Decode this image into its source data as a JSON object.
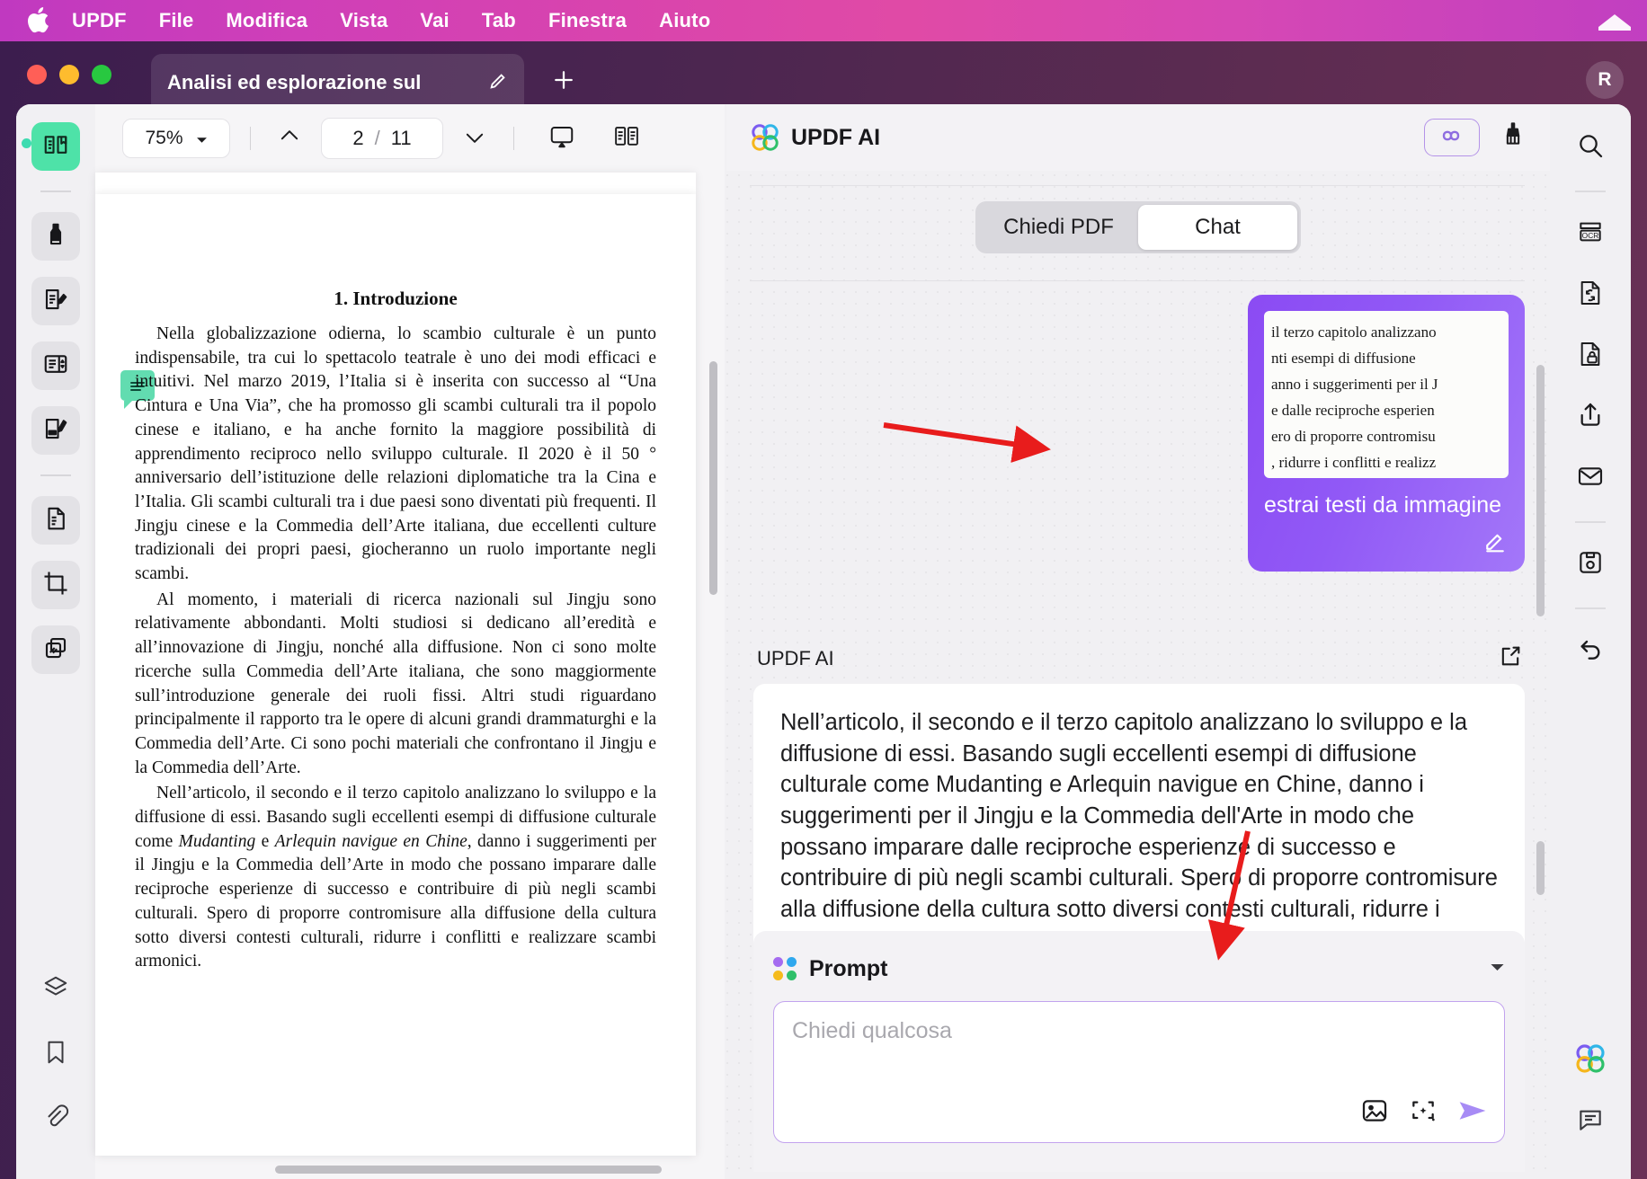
{
  "menubar": {
    "apple_icon": "apple-logo-icon",
    "items": [
      "UPDF",
      "File",
      "Modifica",
      "Vista",
      "Vai",
      "Tab",
      "Finestra",
      "Aiuto"
    ],
    "right_icon": "notification-center-icon"
  },
  "window": {
    "tab_title": "Analisi ed esplorazione sul",
    "tab_edit_icon": "pencil-icon",
    "new_tab_icon": "plus-icon",
    "avatar_initial": "R"
  },
  "left_rail": {
    "tools": [
      {
        "name": "reader-view-tool",
        "icon": "book-open-icon",
        "active": true
      },
      {
        "name": "highlight-tool",
        "icon": "marker-pen-icon",
        "active": false
      },
      {
        "name": "annotate-tool",
        "icon": "document-pencil-icon",
        "active": false
      },
      {
        "name": "edit-pdf-tool",
        "icon": "document-columns-icon",
        "active": false
      },
      {
        "name": "fill-sign-tool",
        "icon": "document-signature-icon",
        "active": false
      },
      {
        "name": "organize-pages-tool",
        "icon": "document-pages-icon",
        "active": false
      },
      {
        "name": "crop-tool",
        "icon": "crop-icon",
        "active": false
      },
      {
        "name": "batch-tool",
        "icon": "stacked-pages-icon",
        "active": false
      },
      {
        "name": "layers-tool",
        "icon": "layers-icon",
        "active": false
      },
      {
        "name": "bookmarks-tool",
        "icon": "bookmark-icon",
        "active": false
      },
      {
        "name": "attachments-tool",
        "icon": "paperclip-icon",
        "active": false
      }
    ]
  },
  "viewer": {
    "zoom_level": "75%",
    "zoom_caret_icon": "chevron-down-icon",
    "prev_page_icon": "chevrons-up-icon",
    "next_page_icon": "chevrons-down-icon",
    "current_page": "2",
    "page_separator": "/",
    "total_pages": "11",
    "present_icon": "presentation-icon",
    "layout_icon": "split-view-icon",
    "annotation_icon": "note-comment-icon"
  },
  "document": {
    "heading": "1. Introduzione",
    "paragraphs": [
      "Nella globalizzazione odierna, lo scambio culturale è un punto indispensabile, tra cui lo spettacolo teatrale è uno dei modi efficaci e intuitivi. Nel marzo 2019, l’Italia si è inserita con successo al “Una Cintura e Una Via”, che ha promosso gli scambi culturali tra il popolo cinese e italiano, e ha anche fornito la maggiore possibilità di apprendimento reciproco nello sviluppo culturale. Il 2020 è il 50 ° anniversario dell’istituzione delle relazioni diplomatiche tra la Cina e l’Italia. Gli scambi culturali tra i due paesi sono diventati più frequenti. Il Jingju cinese e la Commedia dell’Arte italiana, due eccellenti culture tradizionali dei propri paesi, giocheranno un ruolo importante negli scambi.",
      "Al momento, i materiali di ricerca nazionali sul Jingju sono relativamente abbondanti. Molti studiosi si dedicano all’eredità e all’innovazione di Jingju, nonché alla diffusione. Non ci sono molte ricerche sulla Commedia dell’Arte italiana, che sono maggiormente sull’introduzione generale dei ruoli fissi. Altri studi riguardano principalmente il rapporto tra le opere di alcuni grandi drammaturghi e la Commedia dell’Arte. Ci sono pochi materiali che confrontano il Jingju e la Commedia dell’Arte."
    ],
    "paragraph3_parts": {
      "a": "Nell’articolo, il secondo e il terzo capitolo analizzano lo sviluppo e la diffusione di essi. Basando sugli eccellenti esempi di diffusione culturale come ",
      "i1": "Mudanting",
      "b": " e ",
      "i2": "Arlequin navigue en Chine",
      "c": ", danno i suggerimenti per il Jingju e la Commedia dell’Arte in modo che possano imparare dalle reciproche esperienze di successo e contribuire di più negli scambi culturali. Spero di proporre contromisure alla diffusione della cultura sotto diversi contesti culturali, ridurre i conflitti e realizzare scambi armonici."
    }
  },
  "ai_panel": {
    "logo_icon": "updf-ai-clover-icon",
    "title": "UPDF AI",
    "infinity_icon": "infinity-icon",
    "brush_icon": "clear-chat-brush-icon",
    "tabs": [
      {
        "label": "Chiedi PDF",
        "active": false
      },
      {
        "label": "Chat",
        "active": true
      }
    ],
    "user_bubble": {
      "image_lines": [
        "il terzo capitolo analizzano",
        "nti  esempi  di  diffusione",
        "anno i suggerimenti per il J",
        "e dalle reciproche esperien",
        "ero di proporre contromisu",
        ", ridurre i conflitti e realizz"
      ],
      "text": "estrai testi da immagine",
      "edit_icon": "pencil-edit-icon"
    },
    "answer": {
      "label": "UPDF AI",
      "expand_icon": "expand-external-icon",
      "text": "Nell’articolo, il secondo e il terzo capitolo analizzano lo sviluppo e la diffusione di essi. Basando sugli eccellenti esempi di diffusione culturale come Mudanting e Arlequin navigue en Chine, danno i suggerimenti per il Jingju e la Commedia dell'Arte in modo che possano imparare dalle reciproche esperienze di successo e contribuire di più negli scambi culturali. Spero di proporre contromisure alla diffusione della cultura sotto diversi contesti culturali, ridurre i conflitti e realizzare scambi armonici."
    },
    "prompt": {
      "title": "Prompt",
      "caret_icon": "chevron-down-icon",
      "placeholder": "Chiedi qualcosa",
      "value": "",
      "image_icon": "insert-image-icon",
      "screenshot_icon": "screenshot-extract-icon",
      "send_icon": "send-arrow-icon"
    }
  },
  "right_rail": {
    "tools": [
      {
        "name": "search-tool",
        "icon": "search-icon"
      },
      {
        "name": "ocr-tool",
        "icon": "ocr-icon"
      },
      {
        "name": "convert-tool",
        "icon": "document-convert-icon"
      },
      {
        "name": "protect-tool",
        "icon": "document-lock-icon"
      },
      {
        "name": "share-tool",
        "icon": "share-upload-icon"
      },
      {
        "name": "email-tool",
        "icon": "envelope-icon"
      },
      {
        "name": "save-tool",
        "icon": "floppy-save-icon"
      },
      {
        "name": "undo-tool",
        "icon": "undo-arrow-icon"
      },
      {
        "name": "ai-assistant-tool",
        "icon": "updf-ai-clover-icon"
      },
      {
        "name": "comments-tool",
        "icon": "chat-bubble-icon"
      }
    ]
  },
  "colors": {
    "accent_purple": "#8b4bf3",
    "menubar_pink": "#d944ad",
    "active_green": "#4ee2a8",
    "annotation_red": "#e81c1c"
  }
}
